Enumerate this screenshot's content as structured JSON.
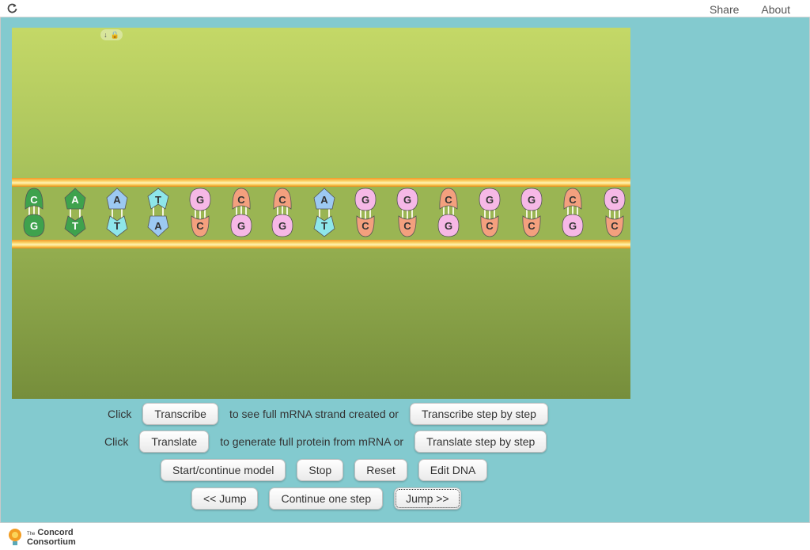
{
  "topbar": {
    "reload_icon": "reload-icon",
    "share_label": "Share",
    "about_label": "About"
  },
  "colors": {
    "background": "#83cacf",
    "cytosine": "#f3a07e",
    "guanine": "#f6b8e6",
    "adenine_dark": "#3ea24d",
    "adenine_light": "#9cc9f2",
    "thymine_light": "#8ee6ea"
  },
  "dna": {
    "top_strand": [
      "C",
      "A",
      "A",
      "T",
      "G",
      "C",
      "C",
      "A",
      "G",
      "G",
      "C",
      "G",
      "G",
      "C",
      "G"
    ],
    "bottom_strand": [
      "G",
      "T",
      "T",
      "A",
      "C",
      "G",
      "G",
      "T",
      "C",
      "C",
      "G",
      "C",
      "C",
      "G",
      "C"
    ]
  },
  "controls": {
    "row1": {
      "click_label": "Click",
      "transcribe_label": "Transcribe",
      "middle_text": "to see full mRNA strand created or",
      "transcribe_step_label": "Transcribe step by step"
    },
    "row2": {
      "click_label": "Click",
      "translate_label": "Translate",
      "middle_text": "to generate full protein from mRNA or",
      "translate_step_label": "Translate step by step"
    },
    "row3": {
      "start_label": "Start/continue model",
      "stop_label": "Stop",
      "reset_label": "Reset",
      "edit_label": "Edit DNA"
    },
    "row4": {
      "jump_back_label": "<< Jump",
      "continue_label": "Continue one step",
      "jump_forward_label": "Jump >>"
    }
  },
  "footer": {
    "logo_small": "The",
    "logo_line1": "Concord",
    "logo_line2": "Consortium"
  }
}
